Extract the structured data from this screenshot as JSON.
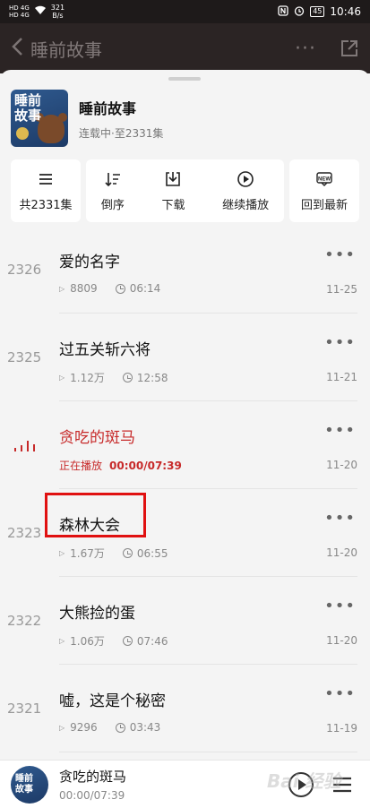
{
  "status_bar": {
    "net_top": "HD 4G",
    "net_bottom": "HD 4G",
    "speed_value": "321",
    "speed_unit": "B/s",
    "battery": "45",
    "time": "10:46"
  },
  "app_bar": {
    "title": "睡前故事",
    "more": "···"
  },
  "album": {
    "cover_text": "睡前\n故事",
    "name": "睡前故事",
    "status": "连载中·至2331集"
  },
  "actions": {
    "total": "共2331集",
    "reverse": "倒序",
    "download": "下载",
    "continue": "继续播放",
    "latest": "回到最新",
    "latest_badge": "NEW"
  },
  "episodes": [
    {
      "num": "2326",
      "title": "爱的名字",
      "plays": "8809",
      "duration": "06:14",
      "date": "11-25"
    },
    {
      "num": "2325",
      "title": "过五关斩六将",
      "plays": "1.12万",
      "duration": "12:58",
      "date": "11-21"
    },
    {
      "num": "",
      "title": "贪吃的斑马",
      "status": "正在播放",
      "progress": "00:00/07:39",
      "date": "11-20"
    },
    {
      "num": "2323",
      "title": "森林大会",
      "plays": "1.67万",
      "duration": "06:55",
      "date": "11-20"
    },
    {
      "num": "2322",
      "title": "大熊捡的蛋",
      "plays": "1.06万",
      "duration": "07:46",
      "date": "11-20"
    },
    {
      "num": "2321",
      "title": "嘘，这是个秘密",
      "plays": "9296",
      "duration": "03:43",
      "date": "11-19"
    }
  ],
  "player": {
    "title": "贪吃的斑马",
    "time": "00:00/07:39",
    "disc_text": "睡前\n故事"
  },
  "watermark": "Bai 经验",
  "colors": {
    "accent": "#c72a2a",
    "highlight_box": "#e01010",
    "app_bar_bg": "#2b2424"
  }
}
